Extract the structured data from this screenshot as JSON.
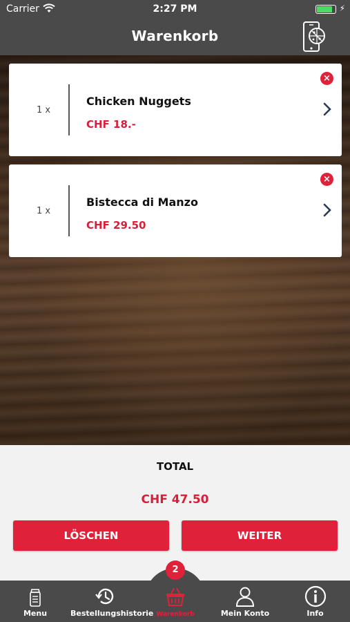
{
  "status_bar": {
    "carrier": "Carrier",
    "time": "2:27 PM"
  },
  "nav": {
    "title": "Warenkorb",
    "icon": "phone-pizza-icon"
  },
  "cart": {
    "items": [
      {
        "qty": "1 x",
        "name": "Chicken Nuggets",
        "price": "CHF 18.-"
      },
      {
        "qty": "1 x",
        "name": "Bistecca di Manzo",
        "price": "CHF 29.50"
      }
    ]
  },
  "summary": {
    "total_label": "TOTAL",
    "total_amount": "CHF 47.50",
    "delete_label": "LÖSCHEN",
    "next_label": "WEITER"
  },
  "tab_bar": {
    "badge": "2",
    "tabs": [
      {
        "label": "Menu",
        "icon": "menu-icon"
      },
      {
        "label": "Bestellungshistorie",
        "icon": "history-icon"
      },
      {
        "label": "Warenkorb",
        "icon": "basket-icon"
      },
      {
        "label": "Mein Konto",
        "icon": "account-icon"
      },
      {
        "label": "Info",
        "icon": "info-icon"
      }
    ]
  },
  "colors": {
    "accent": "#e0213a",
    "bar": "#4a4a4a",
    "panel": "#f2f2f2"
  }
}
